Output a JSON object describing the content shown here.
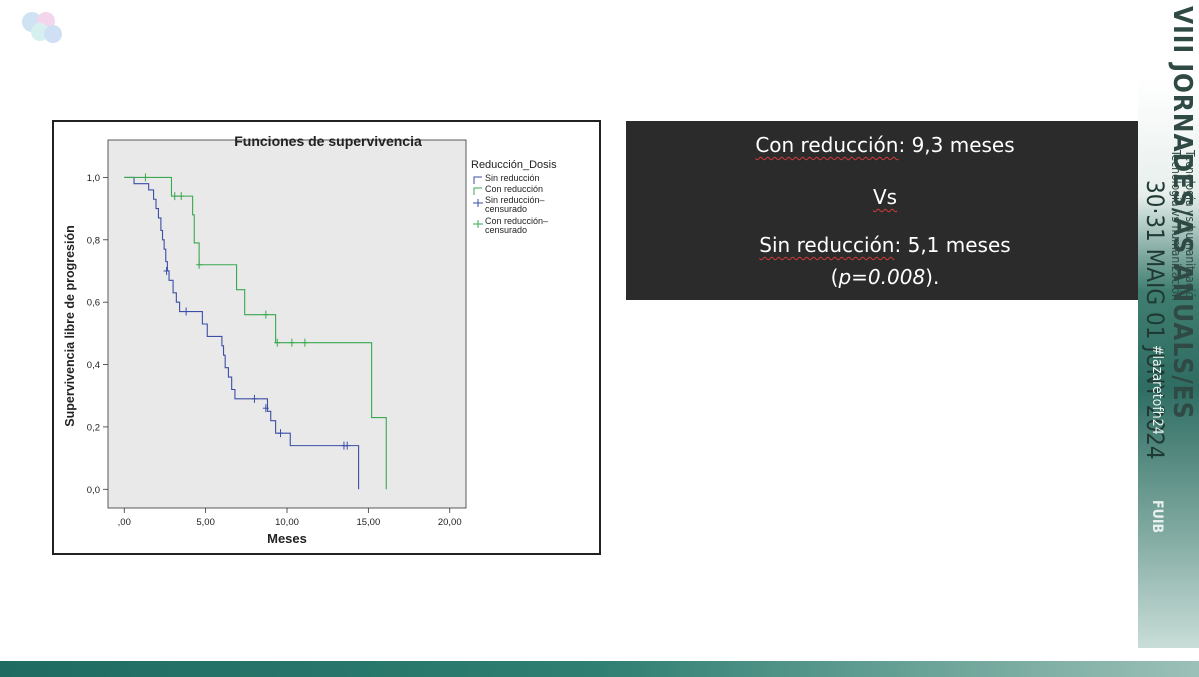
{
  "chart_data": {
    "type": "line",
    "title": "Funciones de supervivencia",
    "xlabel": "Meses",
    "ylabel": "Supervivencia libre de progresión",
    "xlim": [
      -1,
      21
    ],
    "ylim": [
      -0.06,
      1.12
    ],
    "x_ticks": [
      ",00",
      "5,00",
      "10,00",
      "15,00",
      "20,00"
    ],
    "x_tick_values": [
      0,
      5,
      10,
      15,
      20
    ],
    "y_ticks": [
      "0,0",
      "0,2",
      "0,4",
      "0,6",
      "0,8",
      "1,0"
    ],
    "y_tick_values": [
      0,
      0.2,
      0.4,
      0.6,
      0.8,
      1.0
    ],
    "legend_title": "Reducción_Dosis",
    "legend": [
      "Sin reducción",
      "Con reducción",
      "Sin reducción–censurado",
      "Con reducción–censurado"
    ],
    "series": [
      {
        "name": "Sin reducción",
        "color": "#3b4fa8",
        "steps": [
          [
            0,
            1.0
          ],
          [
            0.6,
            0.98
          ],
          [
            1.5,
            0.96
          ],
          [
            1.8,
            0.93
          ],
          [
            1.95,
            0.9
          ],
          [
            2.1,
            0.87
          ],
          [
            2.25,
            0.83
          ],
          [
            2.35,
            0.8
          ],
          [
            2.45,
            0.77
          ],
          [
            2.55,
            0.73
          ],
          [
            2.65,
            0.7
          ],
          [
            2.75,
            0.67
          ],
          [
            3.0,
            0.63
          ],
          [
            3.2,
            0.6
          ],
          [
            3.4,
            0.57
          ],
          [
            4.8,
            0.53
          ],
          [
            5.1,
            0.49
          ],
          [
            6.0,
            0.46
          ],
          [
            6.1,
            0.43
          ],
          [
            6.2,
            0.39
          ],
          [
            6.4,
            0.36
          ],
          [
            6.6,
            0.32
          ],
          [
            6.8,
            0.29
          ],
          [
            8.8,
            0.25
          ],
          [
            9.0,
            0.22
          ],
          [
            9.3,
            0.18
          ],
          [
            10.2,
            0.14
          ],
          [
            14.4,
            0.0
          ]
        ],
        "end_x": 14.4,
        "censored": [
          [
            2.6,
            0.7
          ],
          [
            3.8,
            0.57
          ],
          [
            8.0,
            0.29
          ],
          [
            8.7,
            0.26
          ],
          [
            9.6,
            0.18
          ],
          [
            13.5,
            0.14
          ],
          [
            13.7,
            0.14
          ]
        ]
      },
      {
        "name": "Con reducción",
        "color": "#3aa84f",
        "steps": [
          [
            0,
            1.0
          ],
          [
            2.9,
            0.94
          ],
          [
            4.2,
            0.88
          ],
          [
            4.3,
            0.79
          ],
          [
            4.6,
            0.72
          ],
          [
            6.9,
            0.64
          ],
          [
            7.4,
            0.56
          ],
          [
            9.3,
            0.47
          ],
          [
            15.2,
            0.23
          ],
          [
            16.1,
            0.0
          ]
        ],
        "end_x": 16.1,
        "censored": [
          [
            1.3,
            1.0
          ],
          [
            3.1,
            0.94
          ],
          [
            3.5,
            0.94
          ],
          [
            4.6,
            0.72
          ],
          [
            8.7,
            0.56
          ],
          [
            9.4,
            0.47
          ],
          [
            10.3,
            0.47
          ],
          [
            11.1,
            0.47
          ]
        ]
      }
    ]
  },
  "slide_box": {
    "line1_label": "Con reducción",
    "line1_value": ": 9,3 meses",
    "line2": "Vs",
    "line3_label": "Sin reducción",
    "line3_value": ": 5,1 meses",
    "line4_open": "(",
    "line4_p": "p=0.008",
    "line4_close": ")."
  },
  "banner": {
    "title": "VIII JORNADES/AS ANUALS/ES",
    "line_a": "Tecnologia vs humanització",
    "line_b": "Tecnología vs humanización",
    "dates": "30·31 MAIG 01 JUNY 2024",
    "hashtag": "#lazaretofh24",
    "org": "FUIB"
  },
  "colors": {
    "box_bg": "#2b2b2b",
    "plot_bg": "#e9e9e9",
    "sin_reduccion": "#3b4fa8",
    "con_reduccion": "#3aa84f"
  }
}
